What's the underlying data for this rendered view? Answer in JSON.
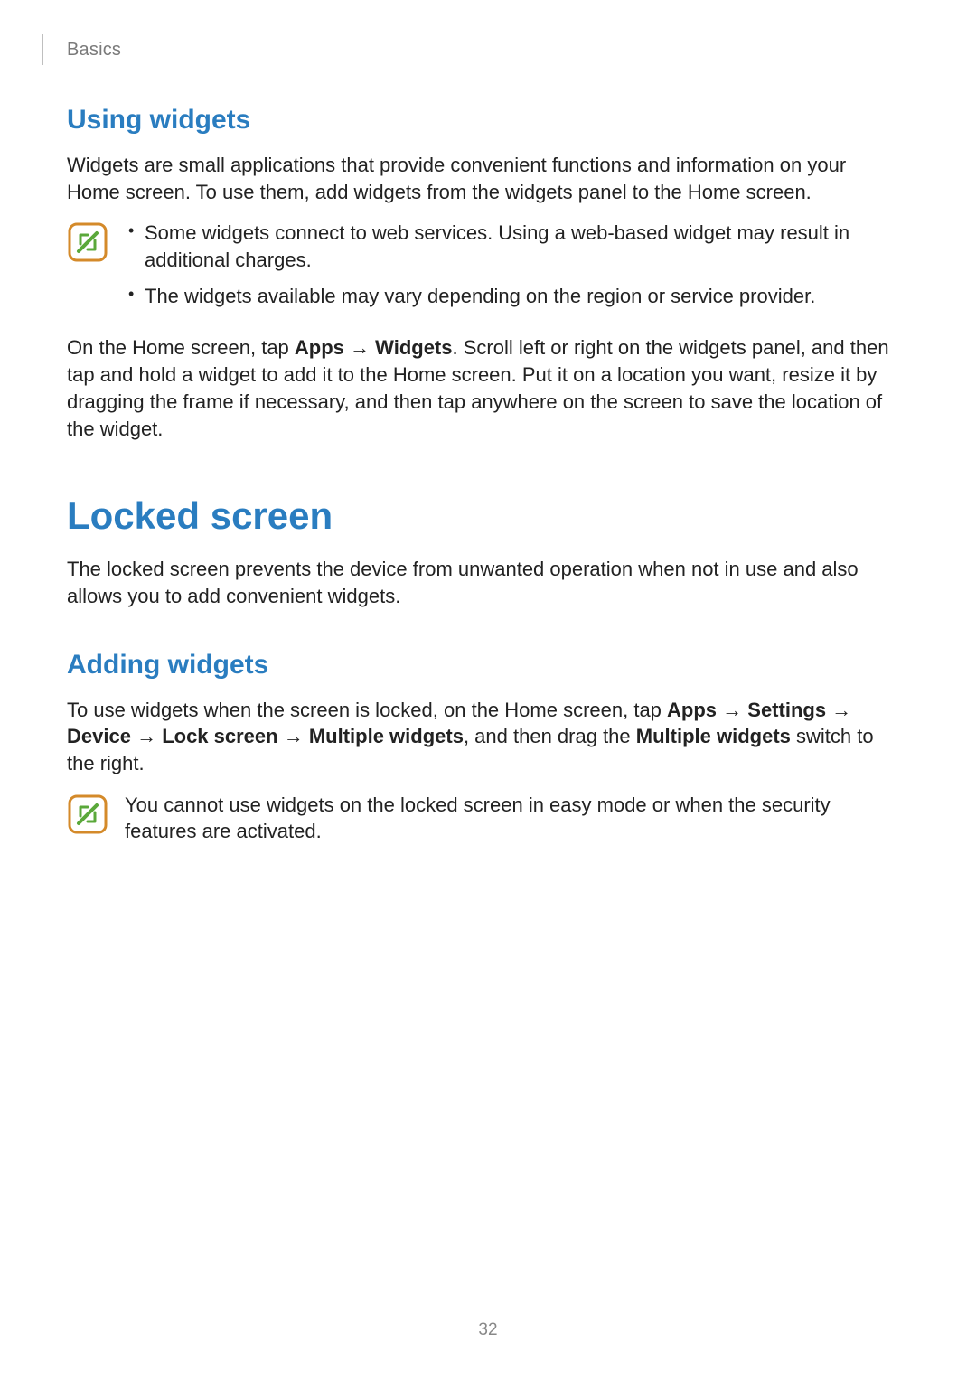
{
  "header": {
    "breadcrumb": "Basics"
  },
  "sections": {
    "using_widgets": {
      "title": "Using widgets",
      "intro": "Widgets are small applications that provide convenient functions and information on your Home screen. To use them, add widgets from the widgets panel to the Home screen.",
      "note_bullets": [
        "Some widgets connect to web services. Using a web-based widget may result in additional charges.",
        "The widgets available may vary depending on the region or service provider."
      ],
      "instruction": {
        "pre": "On the Home screen, tap ",
        "b1": "Apps",
        "arrow1": " → ",
        "b2": "Widgets",
        "post": ". Scroll left or right on the widgets panel, and then tap and hold a widget to add it to the Home screen. Put it on a location you want, resize it by dragging the frame if necessary, and then tap anywhere on the screen to save the location of the widget."
      }
    },
    "locked_screen": {
      "title": "Locked screen",
      "intro": "The locked screen prevents the device from unwanted operation when not in use and also allows you to add convenient widgets."
    },
    "adding_widgets": {
      "title": "Adding widgets",
      "instruction": {
        "pre": "To use widgets when the screen is locked, on the Home screen, tap ",
        "b1": "Apps",
        "arr1": " → ",
        "b2": "Settings",
        "arr2": " → ",
        "b3": "Device",
        "arr3": " → ",
        "b4": "Lock screen",
        "arr4": " → ",
        "b5": "Multiple widgets",
        "mid": ", and then drag the ",
        "b6": "Multiple widgets",
        "post": " switch to the right."
      },
      "note_text": "You cannot use widgets on the locked screen in easy mode or when the security features are activated."
    }
  },
  "icons": {
    "note": "note-icon"
  },
  "page_number": "32"
}
